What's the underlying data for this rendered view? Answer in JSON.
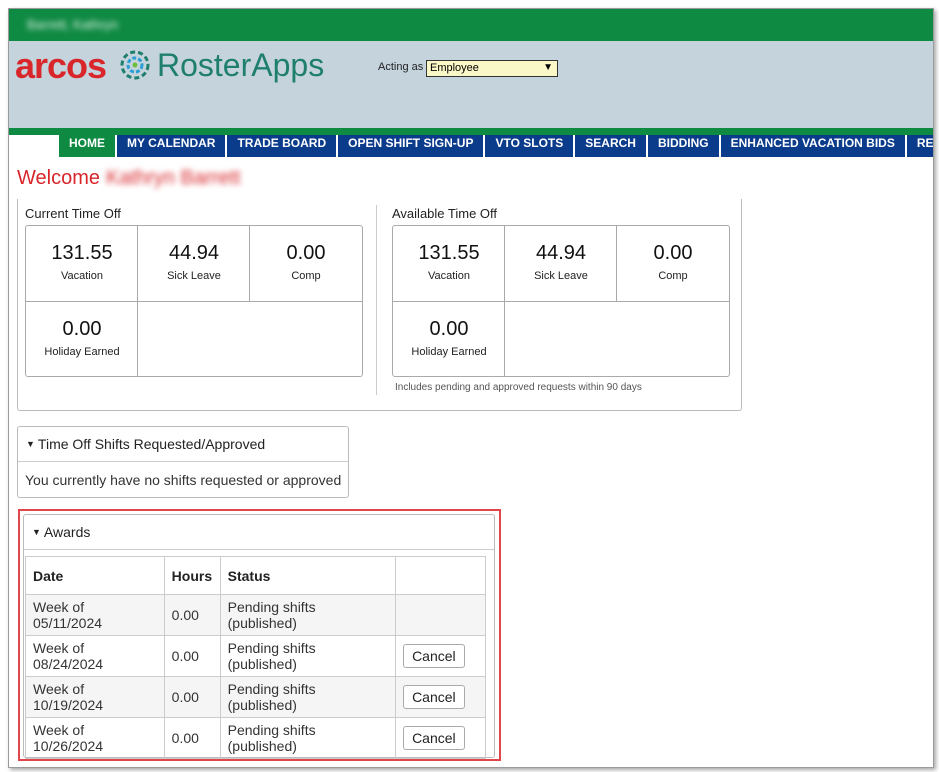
{
  "topbar": {
    "user_name": "Barrett, Kathryn"
  },
  "brand": {
    "arcos": "arcos",
    "rosterapps": "RosterApps"
  },
  "acting": {
    "label": "Acting as",
    "value": "Employee"
  },
  "nav": {
    "tabs": [
      {
        "label": "HOME",
        "active": true
      },
      {
        "label": "MY CALENDAR"
      },
      {
        "label": "TRADE BOARD"
      },
      {
        "label": "OPEN SHIFT SIGN-UP"
      },
      {
        "label": "VTO SLOTS"
      },
      {
        "label": "SEARCH"
      },
      {
        "label": "BIDDING"
      },
      {
        "label": "ENHANCED VACATION BIDS"
      },
      {
        "label": "REPORTS"
      }
    ]
  },
  "welcome": {
    "prefix": "Welcome",
    "name": "Kathryn Barrett"
  },
  "current_time_off": {
    "title": "Current Time Off",
    "items": [
      {
        "value": "131.55",
        "label": "Vacation"
      },
      {
        "value": "44.94",
        "label": "Sick Leave"
      },
      {
        "value": "0.00",
        "label": "Comp"
      },
      {
        "value": "0.00",
        "label": "Holiday Earned"
      }
    ]
  },
  "available_time_off": {
    "title": "Available Time Off",
    "items": [
      {
        "value": "131.55",
        "label": "Vacation"
      },
      {
        "value": "44.94",
        "label": "Sick Leave"
      },
      {
        "value": "0.00",
        "label": "Comp"
      },
      {
        "value": "0.00",
        "label": "Holiday Earned"
      }
    ],
    "note": "Includes pending and approved requests within 90 days"
  },
  "shifts_panel": {
    "title": "Time Off Shifts Requested/Approved",
    "message": "You currently have no shifts requested or approved"
  },
  "awards": {
    "title": "Awards",
    "columns": [
      "Date",
      "Hours",
      "Status",
      ""
    ],
    "rows": [
      {
        "date": "Week of 05/11/2024",
        "hours": "0.00",
        "status": "Pending shifts (published)",
        "action": ""
      },
      {
        "date": "Week of 08/24/2024",
        "hours": "0.00",
        "status": "Pending shifts (published)",
        "action": "Cancel"
      },
      {
        "date": "Week of 10/19/2024",
        "hours": "0.00",
        "status": "Pending shifts (published)",
        "action": "Cancel"
      },
      {
        "date": "Week of 10/26/2024",
        "hours": "0.00",
        "status": "Pending shifts (published)",
        "action": "Cancel"
      }
    ]
  },
  "colors": {
    "green": "#0f8a43",
    "navy": "#0b3c8c",
    "red": "#d8262b",
    "header_bg": "#c5d3dd",
    "highlight": "#e0474c"
  }
}
